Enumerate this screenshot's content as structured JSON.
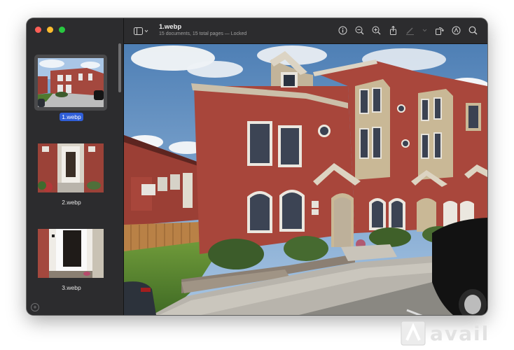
{
  "window": {
    "title": "1.webp",
    "subtitle": "15 documents, 15 total pages — Locked"
  },
  "toolbar": {
    "icons": [
      "sidebar-toggle-icon",
      "info-icon",
      "zoom-out-icon",
      "zoom-in-icon",
      "share-icon",
      "markup-icon",
      "rotate-icon",
      "annotate-icon",
      "search-icon"
    ]
  },
  "sidebar": {
    "thumbnails": [
      {
        "label": "1.webp",
        "selected": true
      },
      {
        "label": "2.webp",
        "selected": false
      },
      {
        "label": "3.webp",
        "selected": false
      }
    ]
  },
  "watermark": {
    "text": "avail"
  },
  "colors": {
    "selection": "#2f5ed8",
    "sidebar_bg": "#2c2c2e",
    "toolbar_bg": "#2c2c2e"
  }
}
